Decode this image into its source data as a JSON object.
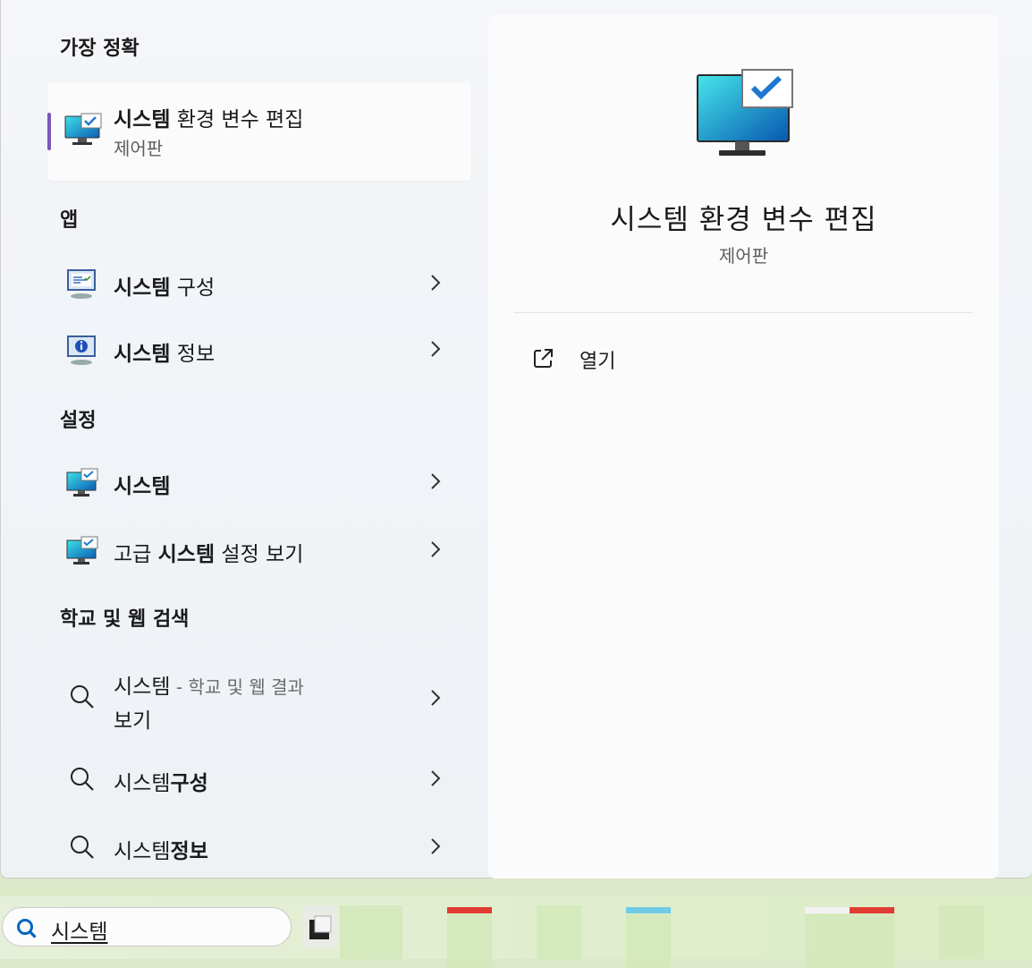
{
  "sections": {
    "best": "가장 정확",
    "apps": "앱",
    "settings": "설정",
    "web": "학교 및 웹 검색"
  },
  "best_match": {
    "title_bold": "시스템",
    "title_rest": " 환경 변수 편집",
    "subtitle": "제어판"
  },
  "apps": [
    {
      "bold": "시스템",
      "rest": " 구성"
    },
    {
      "bold": "시스템",
      "rest": " 정보"
    }
  ],
  "settings": [
    {
      "label": "시스템"
    },
    {
      "pre": "고급 ",
      "bold": "시스템",
      "rest": " 설정 보기"
    }
  ],
  "web": [
    {
      "pre": "시스템",
      "sep": " - ",
      "muted": "학교 및 웹 결과",
      "line2": "보기"
    },
    {
      "pre": "시스템",
      "bold": "구성"
    },
    {
      "pre": "시스템",
      "bold": "정보"
    }
  ],
  "preview": {
    "title": "시스템 환경 변수 편집",
    "subtitle": "제어판",
    "action_open": "열기"
  },
  "taskbar": {
    "search_text": "시스템"
  },
  "colors": {
    "accent": "#7b58b6",
    "search_blue": "#0067c0"
  }
}
